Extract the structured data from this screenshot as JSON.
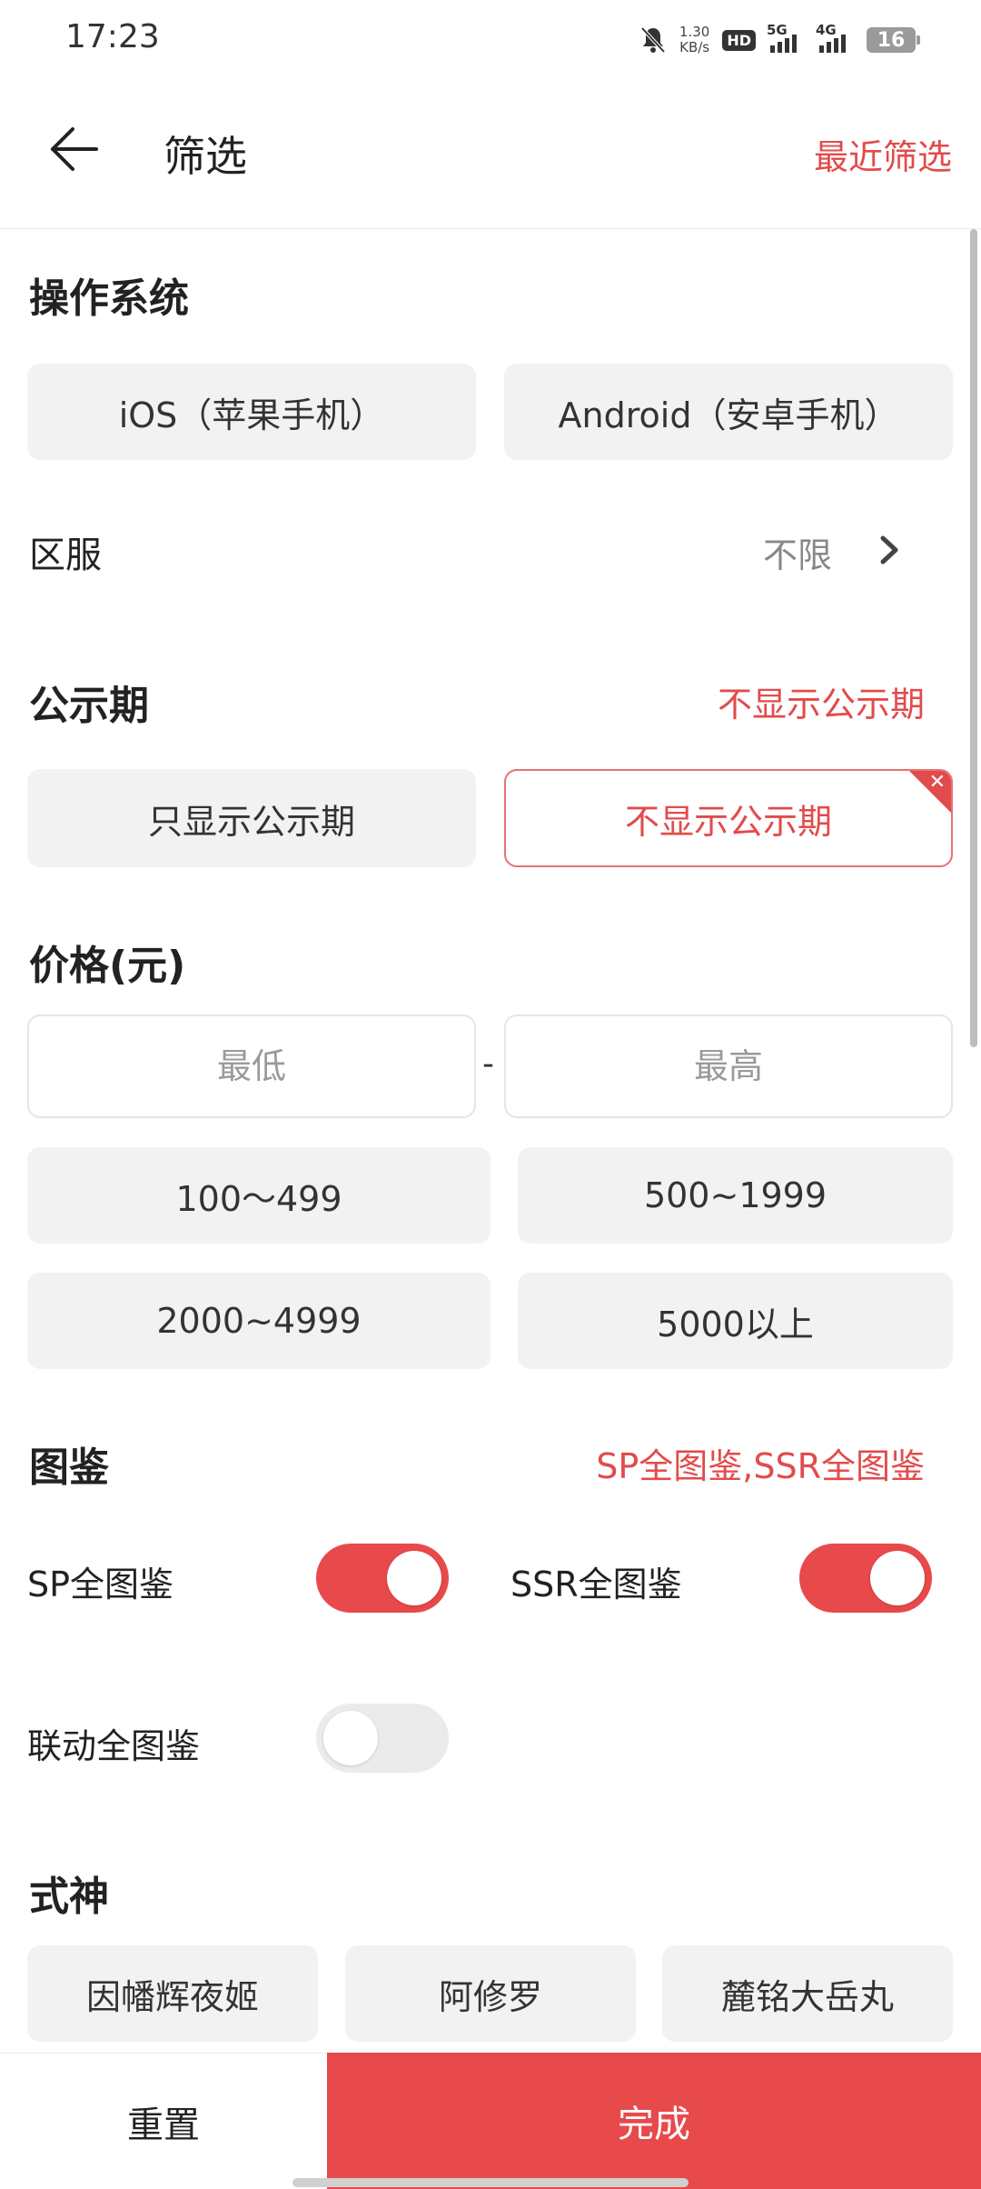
{
  "status_bar": {
    "time": "17:23",
    "net_speed_value": "1.30",
    "net_speed_unit": "KB/s",
    "hd_label": "HD",
    "signal1_label": "5G",
    "signal2_label": "4G",
    "battery": "16",
    "icons": [
      "mute-bell-icon",
      "hd-icon",
      "signal-5g-icon",
      "signal-4g-icon",
      "battery-icon"
    ]
  },
  "header": {
    "title": "筛选",
    "recent_filter": "最近筛选",
    "back_icon": "arrow-left-icon"
  },
  "os_section": {
    "title": "操作系统",
    "options": [
      "iOS（苹果手机）",
      "Android（安卓手机）"
    ]
  },
  "region": {
    "label": "区服",
    "value": "不限",
    "icon": "chevron-right-icon"
  },
  "publicity_section": {
    "title": "公示期",
    "selected_text": "不显示公示期",
    "options": [
      "只显示公示期",
      "不显示公示期"
    ],
    "selected_index": 1
  },
  "price_section": {
    "title": "价格(元)",
    "min_placeholder": "最低",
    "max_placeholder": "最高",
    "separator": "-",
    "ranges": [
      "100～499",
      "500~1999",
      "2000~4999",
      "5000以上"
    ]
  },
  "illustration_section": {
    "title": "图鉴",
    "selected_text": "SP全图鉴,SSR全图鉴",
    "toggles": [
      {
        "label": "SP全图鉴",
        "on": true
      },
      {
        "label": "SSR全图鉴",
        "on": true
      },
      {
        "label": "联动全图鉴",
        "on": false
      }
    ]
  },
  "shikigami_section": {
    "title": "式神",
    "options": [
      "因幡辉夜姬",
      "阿修罗",
      "麓铭大岳丸"
    ]
  },
  "bottom_bar": {
    "reset_label": "重置",
    "done_label": "完成"
  },
  "colors": {
    "accent": "#e8494b",
    "chip_bg": "#f2f2f2"
  }
}
